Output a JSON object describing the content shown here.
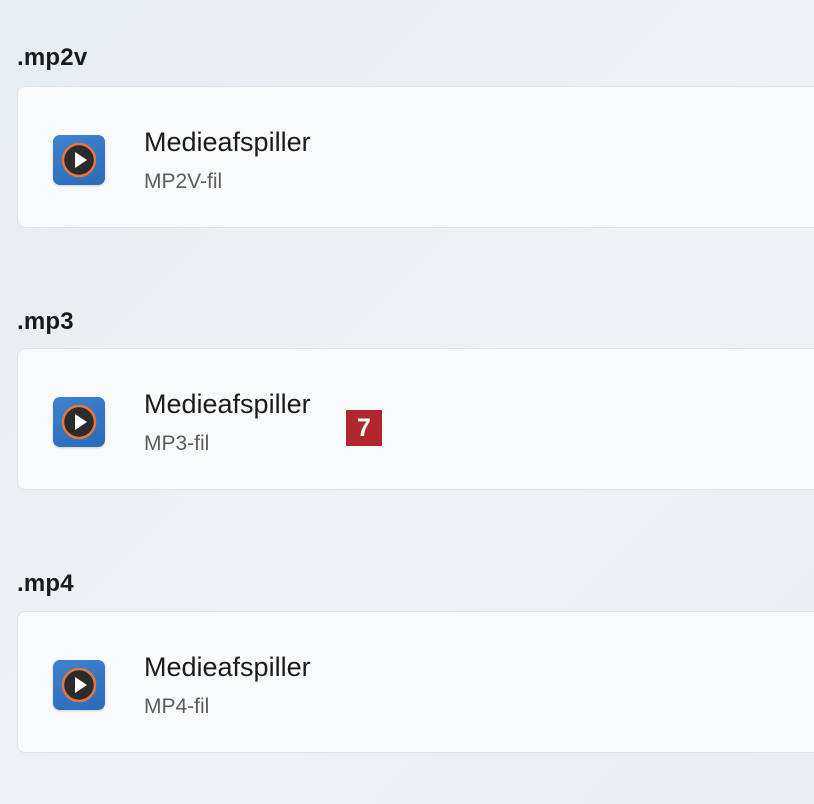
{
  "associations": [
    {
      "extension": ".mp2v",
      "app_name": "Medieafspiller",
      "file_type": "MP2V-fil",
      "app_icon": "media-player-icon"
    },
    {
      "extension": ".mp3",
      "app_name": "Medieafspiller",
      "file_type": "MP3-fil",
      "app_icon": "media-player-icon"
    },
    {
      "extension": ".mp4",
      "app_name": "Medieafspiller",
      "file_type": "MP4-fil",
      "app_icon": "media-player-icon"
    }
  ],
  "callout": {
    "label": "7",
    "color": "#b0282d"
  },
  "colors": {
    "icon_tile": "#2f72c0",
    "icon_ring": "#e8763a",
    "icon_disc": "#2b2b2b"
  }
}
